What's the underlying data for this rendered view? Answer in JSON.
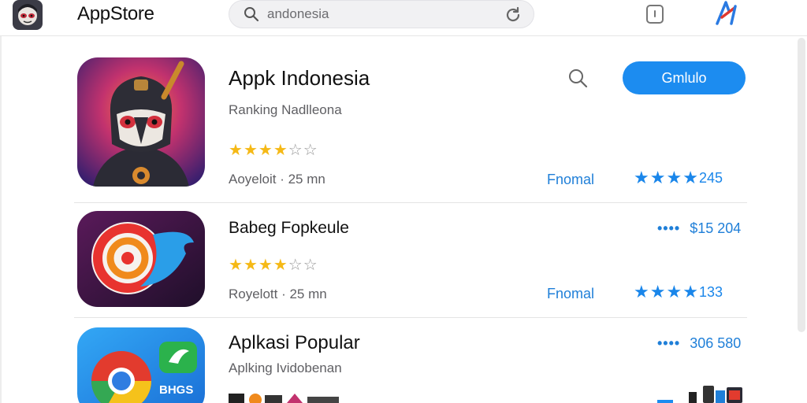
{
  "header": {
    "app_title": "AppStore",
    "search_value": "andonesia",
    "logo_icon": "masked-character-avatar",
    "search_icon": "search-icon",
    "refresh_icon": "refresh-icon",
    "device_icon": "tablet-icon",
    "brand_icon": "brand-logo-icon"
  },
  "apps": [
    {
      "name": "Appk Indonesia",
      "subtitle": "Ranking Nadlleona",
      "rating_stars": 4,
      "meta": "Aoyeloit · 25 mn",
      "category": "Fnomal",
      "review_count": "245",
      "action_label": "Gmlulo"
    },
    {
      "name": "Babeg Fopkeule",
      "rating_stars": 4,
      "meta": "Royelott · 25 mn",
      "category": "Fnomal",
      "review_count": "133",
      "price": "$15 204"
    },
    {
      "name": "Aplkasi Popular",
      "subtitle": "Aplking Ividobenan",
      "price": "306 580",
      "icon_badge": "BHGS"
    }
  ],
  "colors": {
    "accent": "#1c8cf0",
    "star": "#f5b916",
    "link": "#1f7fd8"
  }
}
